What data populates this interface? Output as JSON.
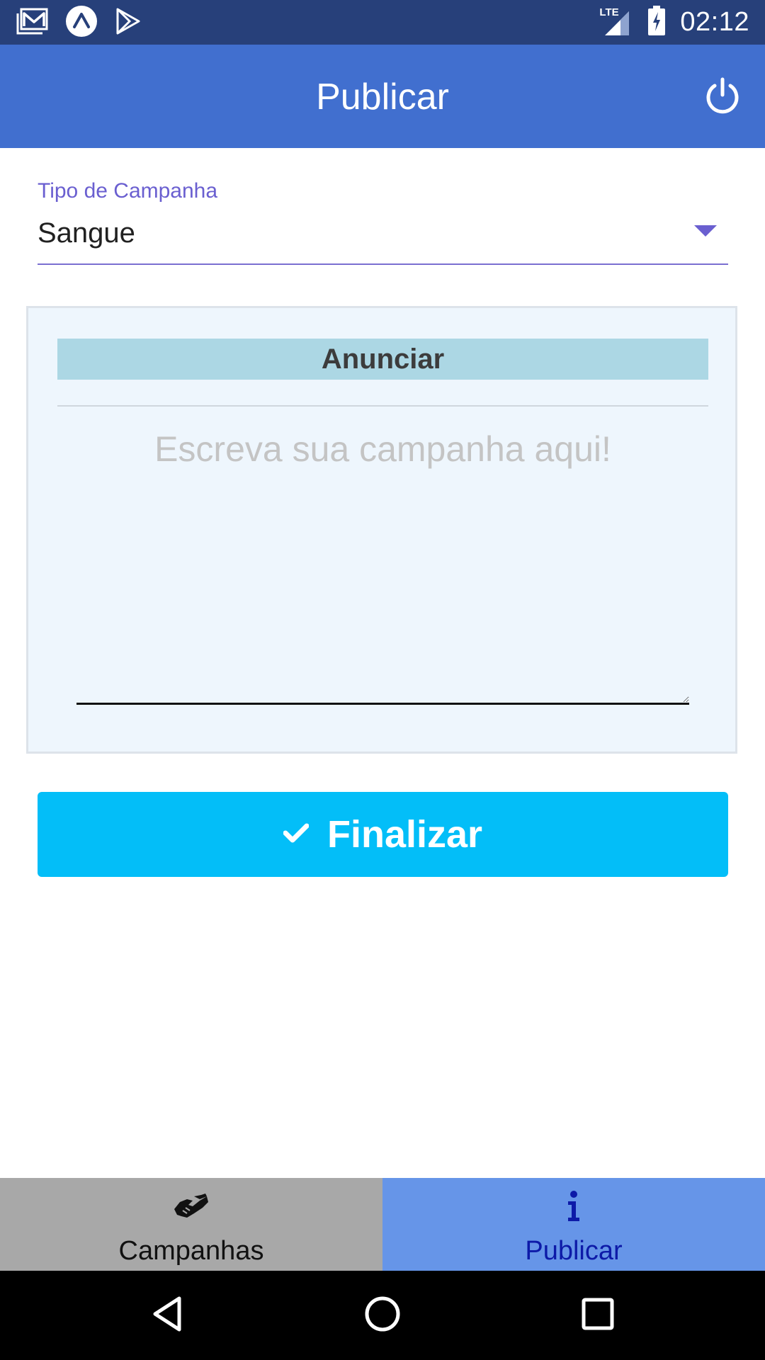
{
  "status_bar": {
    "time": "02:12",
    "network": "LTE",
    "icons": [
      "gmail-icon",
      "expo-icon",
      "play-store-icon",
      "lte-signal-icon",
      "battery-charging-icon"
    ]
  },
  "app_bar": {
    "title": "Publicar",
    "action_icon": "power-icon"
  },
  "campaign_type": {
    "label": "Tipo de Campanha",
    "selected": "Sangue"
  },
  "card": {
    "header": "Anunciar",
    "input_placeholder": "Escreva sua campanha aqui!",
    "input_value": ""
  },
  "finish_button": {
    "label": "Finalizar",
    "icon": "check-icon"
  },
  "tabs": [
    {
      "label": "Campanhas",
      "icon": "handshake-icon",
      "active": false
    },
    {
      "label": "Publicar",
      "icon": "info-icon",
      "active": true
    }
  ],
  "colors": {
    "status_bar": "#27407a",
    "app_bar": "#416fcf",
    "accent": "#6a5fd0",
    "finish_button": "#03bef8",
    "tab_inactive": "#a8a8a8",
    "tab_active": "#6695e8"
  }
}
